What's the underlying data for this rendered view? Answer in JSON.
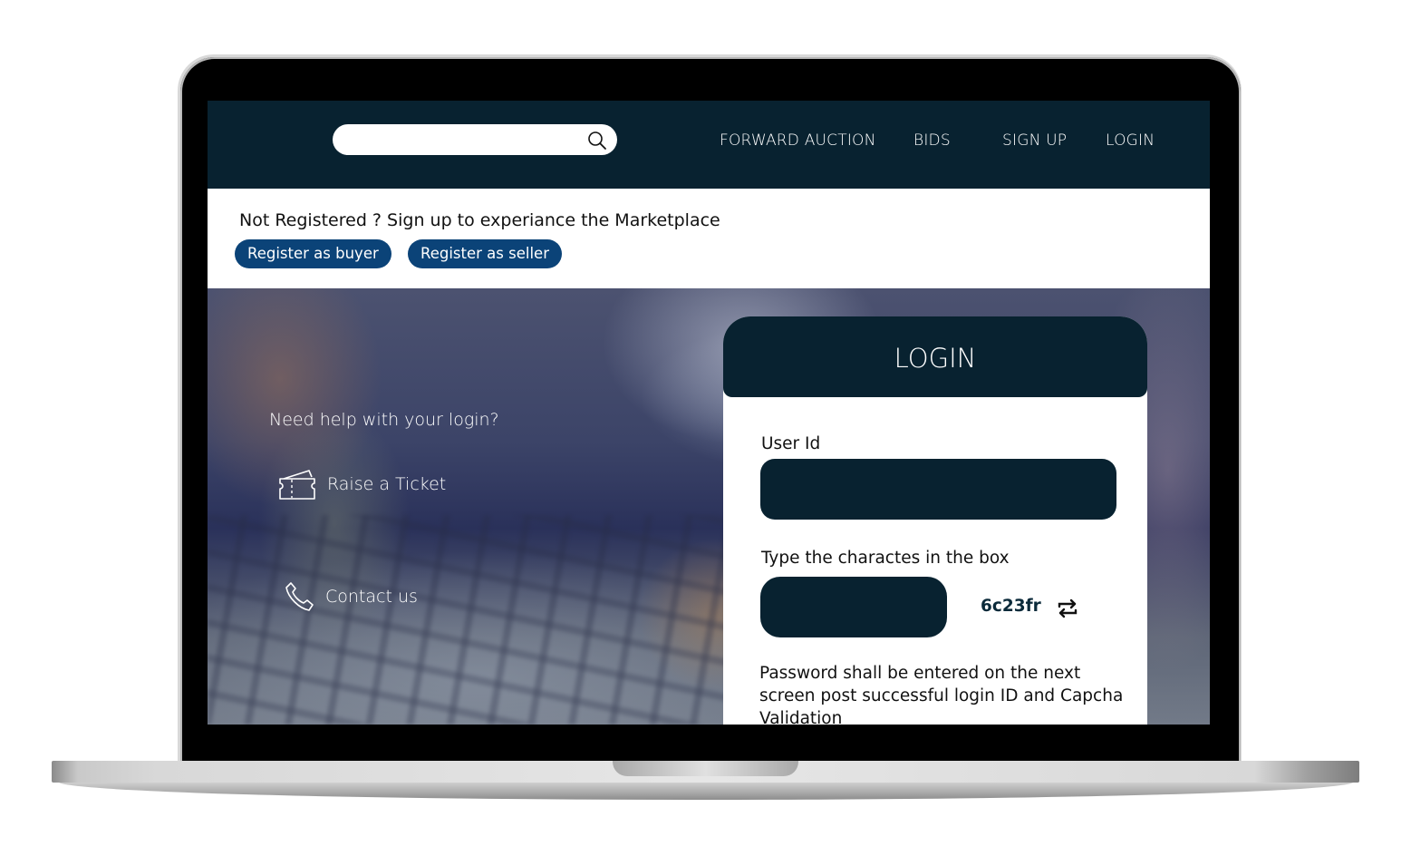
{
  "nav": {
    "search": {
      "value": "",
      "placeholder": ""
    },
    "links": [
      "FORWARD AUCTION",
      "BIDS",
      "SIGN UP",
      "LOGIN"
    ]
  },
  "register": {
    "prompt": "Not Registered ? Sign up to experiance the Marketplace",
    "buyer_label": "Register as buyer",
    "seller_label": "Register as seller"
  },
  "help": {
    "title": "Need help with your login?",
    "ticket_label": "Raise a Ticket",
    "contact_label": "Contact us"
  },
  "login": {
    "title": "LOGIN",
    "user_id_label": "User Id",
    "user_id_value": "",
    "captcha_label": "Type the charactes in the box",
    "captcha_value": "",
    "captcha_code": "6c23fr",
    "note": "Password shall be entered on the next screen post successful login ID and Capcha Validation"
  },
  "colors": {
    "nav_bg": "#082230",
    "button_blue": "#0b4378",
    "field_bg": "#082230"
  }
}
